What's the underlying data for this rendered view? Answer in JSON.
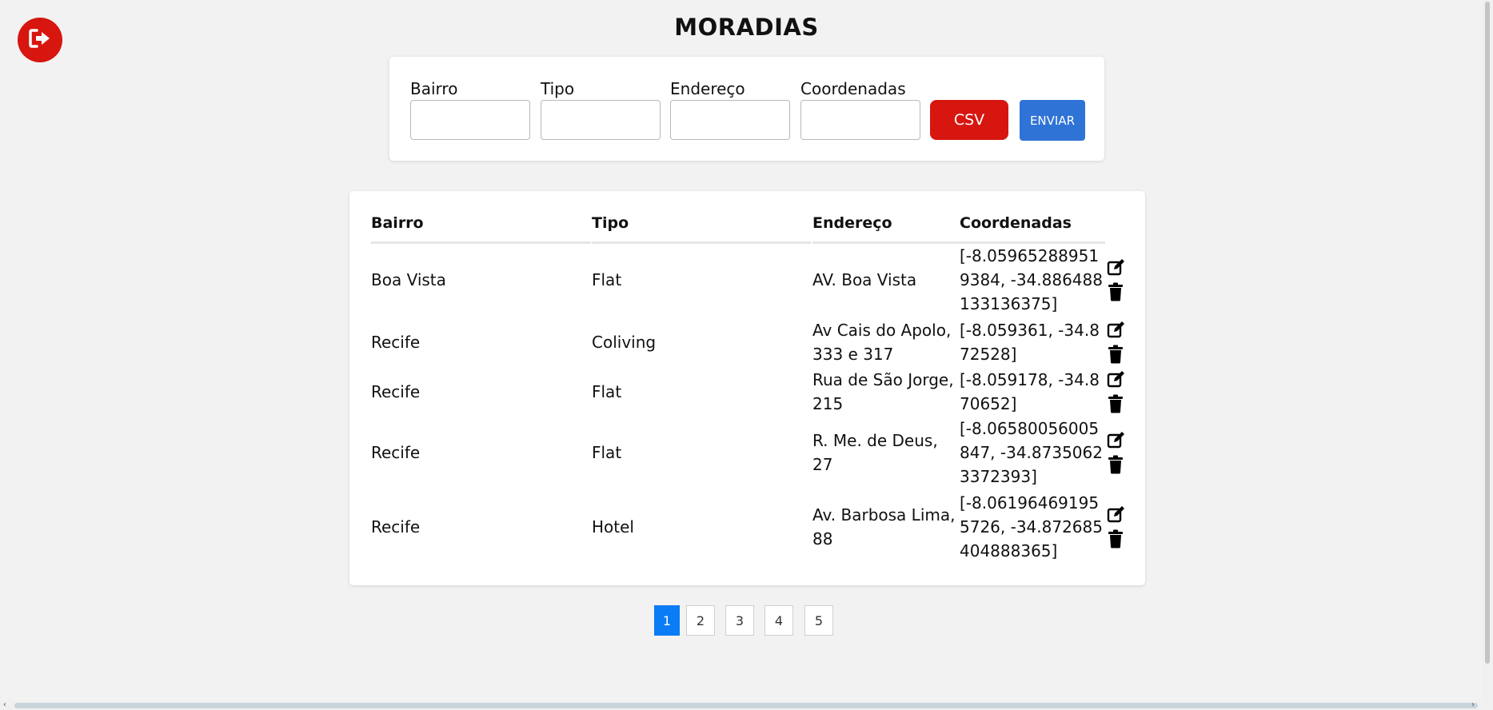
{
  "page": {
    "title": "MORADIAS"
  },
  "form": {
    "fields": [
      {
        "label": "Bairro",
        "value": "",
        "placeholder": ""
      },
      {
        "label": "Tipo",
        "value": "",
        "placeholder": ""
      },
      {
        "label": "Endereço",
        "value": "",
        "placeholder": ""
      },
      {
        "label": "Coordenadas",
        "value": "",
        "placeholder": ""
      }
    ],
    "csv_label": "CSV",
    "send_label": "ENVIAR"
  },
  "table": {
    "headers": [
      "Bairro",
      "Tipo",
      "Endereço",
      "Coordenadas"
    ],
    "rows": [
      {
        "bairro": "Boa Vista",
        "tipo": "Flat",
        "endereco": "AV. Boa Vista",
        "coordenadas": "[-8.059652889519384, -34.886488133136375]"
      },
      {
        "bairro": "Recife",
        "tipo": "Coliving",
        "endereco": "Av Cais do Apolo, 333 e 317",
        "coordenadas": "[-8.059361, -34.872528]"
      },
      {
        "bairro": "Recife",
        "tipo": "Flat",
        "endereco": "Rua de São Jorge, 215",
        "coordenadas": "[-8.059178, -34.870652]"
      },
      {
        "bairro": "Recife",
        "tipo": "Flat",
        "endereco": "R. Me. de Deus, 27",
        "coordenadas": "[-8.06580056005847, -34.87350623372393]"
      },
      {
        "bairro": "Recife",
        "tipo": "Hotel",
        "endereco": "Av. Barbosa Lima, 88",
        "coordenadas": "[-8.061964691955726, -34.872685404888365]"
      }
    ]
  },
  "pagination": {
    "pages": [
      "1",
      "2",
      "3",
      "4",
      "5"
    ],
    "current": "1"
  },
  "icons": {
    "logout": "logout-icon",
    "edit": "edit-icon",
    "delete": "trash-icon"
  },
  "colors": {
    "danger": "#d6160f",
    "primary": "#2f73d6",
    "active_page": "#0a7cf5",
    "background": "#f2f2f2"
  }
}
